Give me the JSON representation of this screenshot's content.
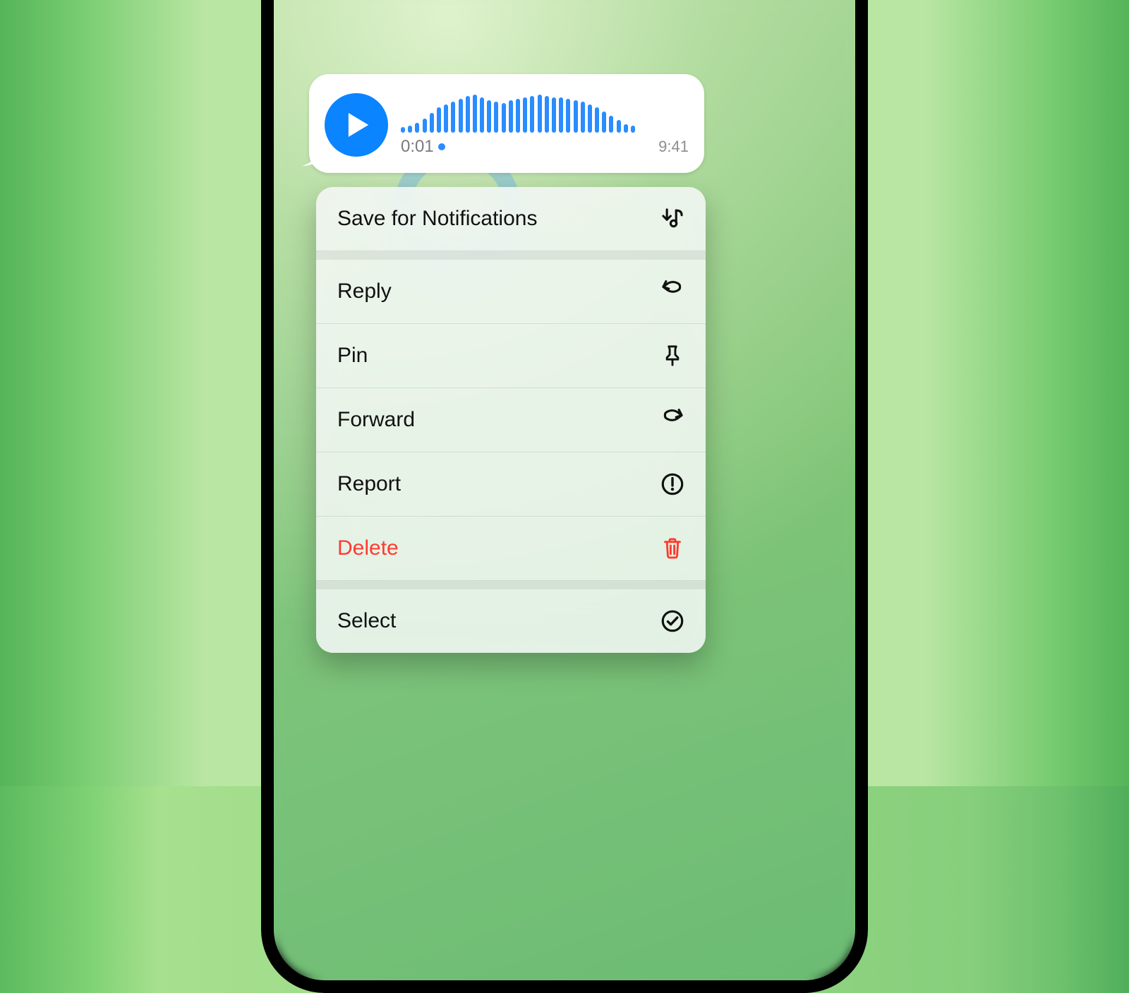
{
  "voice_message": {
    "duration": "0:01",
    "unplayed": true,
    "timestamp": "9:41",
    "waveform_heights": [
      8,
      10,
      14,
      20,
      28,
      36,
      40,
      44,
      48,
      52,
      54,
      50,
      46,
      44,
      42,
      46,
      48,
      50,
      52,
      54,
      52,
      50,
      50,
      48,
      46,
      44,
      40,
      36,
      30,
      24,
      18,
      12,
      10
    ]
  },
  "menu": {
    "groups": [
      {
        "items": [
          {
            "key": "save-notifications",
            "label": "Save for Notifications",
            "icon": "save-tone"
          }
        ]
      },
      {
        "items": [
          {
            "key": "reply",
            "label": "Reply",
            "icon": "reply"
          },
          {
            "key": "pin",
            "label": "Pin",
            "icon": "pin"
          },
          {
            "key": "forward",
            "label": "Forward",
            "icon": "forward"
          },
          {
            "key": "report",
            "label": "Report",
            "icon": "report"
          },
          {
            "key": "delete",
            "label": "Delete",
            "icon": "trash",
            "destructive": true
          }
        ]
      },
      {
        "items": [
          {
            "key": "select",
            "label": "Select",
            "icon": "select"
          }
        ]
      }
    ]
  },
  "colors": {
    "accent": "#0a84ff",
    "destructive": "#ff3b30"
  }
}
